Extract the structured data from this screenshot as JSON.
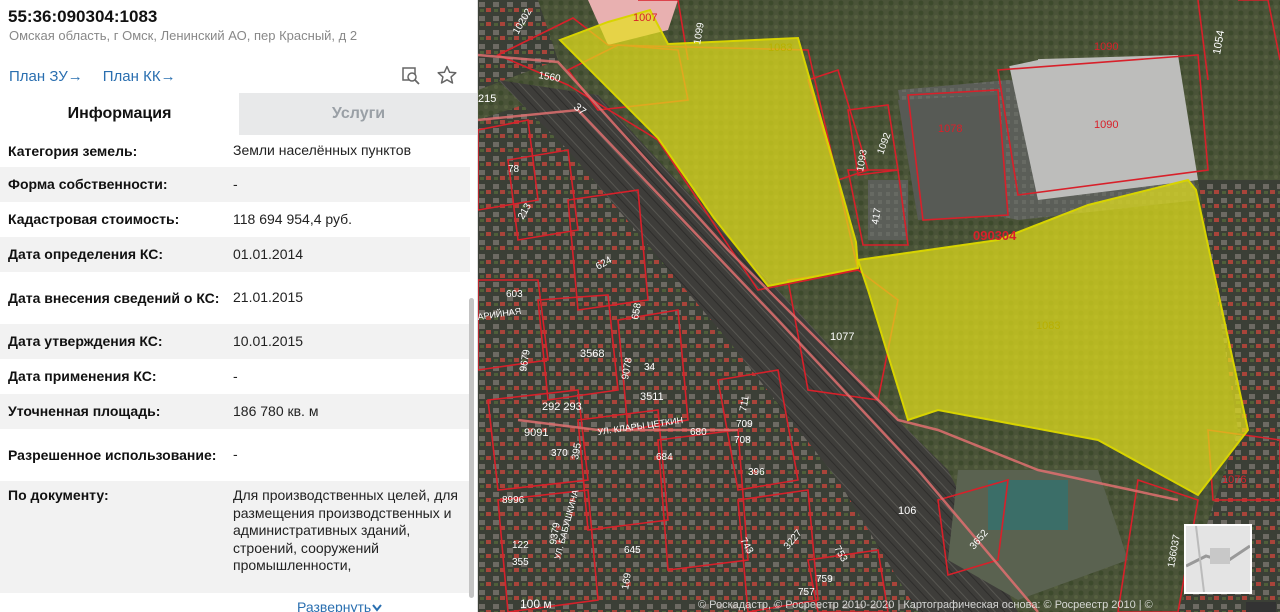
{
  "panel": {
    "title": "55:36:090304:1083",
    "address": "Омская область, г Омск, Ленинский АО, пер Красный, д 2",
    "plan_zu": "План ЗУ",
    "plan_kk": "План КК",
    "plan_arrow": "→",
    "tabs": {
      "info": "Информация",
      "services": "Услуги"
    },
    "rows": [
      {
        "k": "Категория земель:",
        "v": "Земли населённых пунктов"
      },
      {
        "k": "Форма собственности:",
        "v": "-"
      },
      {
        "k": "Кадастровая стоимость:",
        "v": "118 694 954,4 руб."
      },
      {
        "k": "Дата определения КС:",
        "v": "01.01.2014"
      },
      {
        "k": "Дата внесения сведений о КС:",
        "v": "21.01.2015"
      },
      {
        "k": "Дата утверждения КС:",
        "v": "10.01.2015"
      },
      {
        "k": "Дата применения КС:",
        "v": "-"
      },
      {
        "k": "Уточненная площадь:",
        "v": "186 780 кв. м"
      },
      {
        "k": "Разрешенное использование:",
        "v": "-"
      },
      {
        "k": "По документу:",
        "v": "Для производственных целей, для размещения производственных и административных зданий, строений, сооружений промышленности,"
      }
    ],
    "expand": "Развернуть"
  },
  "map": {
    "scale": "100 м",
    "copyright": "© Роскадастр, © Росреестр 2010-2020 | Картографическая основа: © Росреестр 2010 | ©",
    "highlight_color": "#e6e21b",
    "boundary_color": "#d8202a",
    "labels": {
      "main": "1083",
      "main2": "1083",
      "quarter": "090304",
      "l1007": "1007",
      "l1090a": "1090",
      "l1090b": "1090",
      "l1054": "1054",
      "l1078": "1078",
      "l1560": "1560",
      "l37": "37",
      "l1093": "1093",
      "l1092": "1092",
      "l417": "417",
      "l1077": "1077",
      "l1076": "1076",
      "l106": "106",
      "l3652": "3652",
      "l136037": "136037",
      "l10202": "10202",
      "l1099": "1099",
      "l215": "215",
      "l78": "78",
      "l213": "213",
      "l624": "624",
      "l603": "603",
      "l658": "658",
      "l3568": "3568",
      "l9078": "9078",
      "l3511": "3511",
      "l292": "292 293",
      "l9091": "9091",
      "l680": "680",
      "l711": "711",
      "l709": "709",
      "l708": "708",
      "l684": "684",
      "l370": "370",
      "l395": "395",
      "l8996": "8996",
      "l122": "122",
      "l355": "355",
      "l645": "645",
      "l743": "743",
      "l753": "753",
      "l759": "759",
      "l757": "757",
      "l169": "169",
      "l3227": "3227",
      "l34": "34",
      "l396": "396",
      "l9679": "9679",
      "l9379": "9379",
      "street1": "УЛ. КЛАРЫ ЦЕТКИН",
      "street2": "УЛ. БАБУШКИНА",
      "street3": "АРИЙНАЯ"
    }
  }
}
